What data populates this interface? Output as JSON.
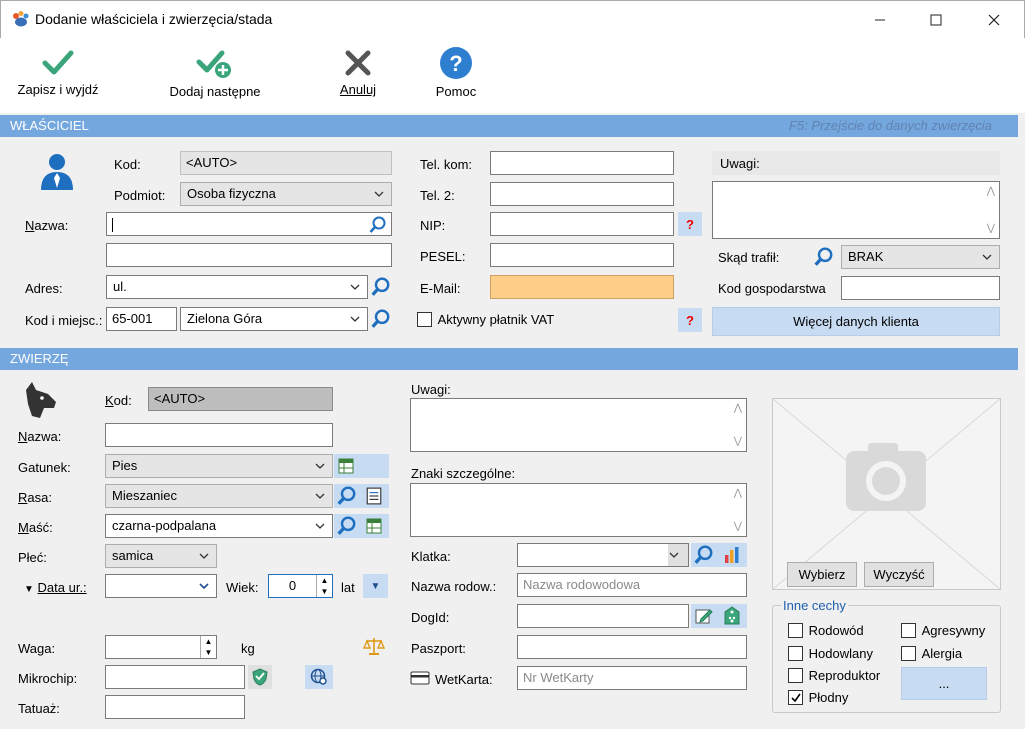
{
  "window": {
    "title": "Dodanie właściciela i zwierzęcia/stada"
  },
  "toolbar": {
    "save_exit": "Zapisz i wyjdź",
    "add_next": "Dodaj następne",
    "cancel": "Anuluj",
    "help": "Pomoc"
  },
  "owner": {
    "header": "WŁAŚCICIEL",
    "hint": "F5: Przejście do danych zwierzęcia",
    "kod_label": "Kod:",
    "kod_value": "<AUTO>",
    "podmiot_label": "Podmiot:",
    "podmiot_value": "Osoba fizyczna",
    "nazwa_label": "Nazwa:",
    "nazwa_value": "",
    "nazwa2_value": "",
    "adres_label": "Adres:",
    "adres_value": "ul.",
    "kod_miejsc_label": "Kod i miejsc.:",
    "postal_code": "65-001",
    "city": "Zielona Góra",
    "tel_kom_label": "Tel. kom:",
    "tel2_label": "Tel. 2:",
    "nip_label": "NIP:",
    "pesel_label": "PESEL:",
    "email_label": "E-Mail:",
    "vat_label": "Aktywny płatnik VAT",
    "uwagi_label": "Uwagi:",
    "skad_label": "Skąd trafił:",
    "skad_value": "BRAK",
    "kod_gosp_label": "Kod gospodarstwa",
    "more_button": "Więcej danych klienta"
  },
  "animal": {
    "header": "ZWIERZĘ",
    "kod_label": "Kod:",
    "kod_value": "<AUTO>",
    "nazwa_label": "Nazwa:",
    "gatunek_label": "Gatunek:",
    "gatunek_value": "Pies",
    "rasa_label": "Rasa:",
    "rasa_value": "Mieszaniec",
    "masc_label": "Maść:",
    "masc_value": "czarna-podpalana",
    "plec_label": "Płeć:",
    "plec_value": "samica",
    "data_label": "Data ur.:",
    "wiek_label": "Wiek:",
    "wiek_value": "0",
    "lat_label": "lat",
    "waga_label": "Waga:",
    "kg_label": "kg",
    "mikrochip_label": "Mikrochip:",
    "tatuaz_label": "Tatuaż:",
    "uwagi_label": "Uwagi:",
    "znaki_label": "Znaki szczególne:",
    "klatka_label": "Klatka:",
    "nazwa_rod_label": "Nazwa rodow.:",
    "nazwa_rod_placeholder": "Nazwa rodowodowa",
    "dogid_label": "DogId:",
    "paszport_label": "Paszport:",
    "wetkarta_label": "WetKarta:",
    "wetkarta_placeholder": "Nr WetKarty",
    "photo_choose": "Wybierz",
    "photo_clear": "Wyczyść",
    "inne_cechy_label": "Inne cechy",
    "traits": {
      "rodowod": "Rodowód",
      "hodowlany": "Hodowlany",
      "reproduktor": "Reproduktor",
      "plodny": "Płodny",
      "agresywny": "Agresywny",
      "alergia": "Alergia"
    },
    "more_dots": "..."
  }
}
